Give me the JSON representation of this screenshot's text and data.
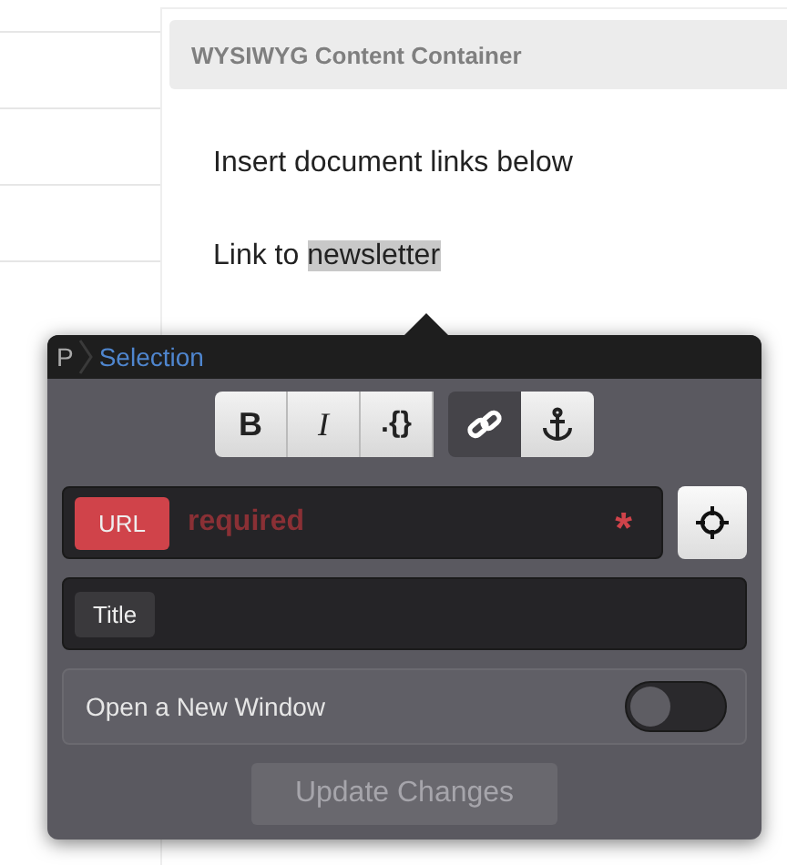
{
  "container": {
    "title": "WYSIWYG Content Container",
    "paragraphs": [
      [
        {
          "text": "Insert document links below",
          "selected": false
        }
      ],
      [
        {
          "text": "Link to ",
          "selected": false
        },
        {
          "text": "newsletter",
          "selected": true
        }
      ]
    ]
  },
  "popup": {
    "breadcrumb": [
      {
        "text": "P",
        "current": false
      },
      {
        "text": "Selection",
        "current": true
      }
    ],
    "toolbar": [
      {
        "kind": "bold",
        "label": "B",
        "selected": false
      },
      {
        "kind": "italic",
        "label": "I",
        "selected": false
      },
      {
        "kind": "code",
        "label": ".{}",
        "selected": false
      },
      {
        "kind": "link",
        "selected": true
      },
      {
        "kind": "anchor",
        "selected": false
      }
    ],
    "url": {
      "label": "URL",
      "placeholder": "required",
      "required_mark": "*"
    },
    "title_field": {
      "label": "Title"
    },
    "open_new_window": {
      "label": "Open a New Window",
      "on": false
    },
    "update_button": {
      "label": "Update Changes",
      "disabled": true
    }
  }
}
